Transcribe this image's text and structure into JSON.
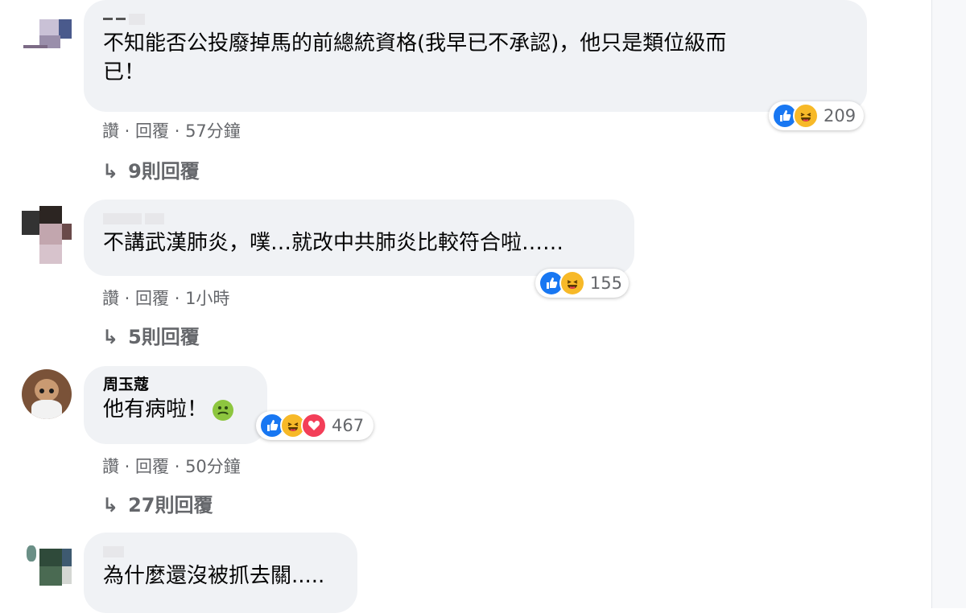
{
  "comments": [
    {
      "author": "",
      "text_line1": "不知能否公投廢掉馬的前總統資格(我早已不承認)，他只是類位級而",
      "text_line2": "已！",
      "like_label": "讚",
      "reply_label": "回覆",
      "time": "57分鐘",
      "reaction_count": "209",
      "replies_label": "9則回覆"
    },
    {
      "author": "",
      "text_line1": "不講武漢肺炎，噗…就改中共肺炎比較符合啦……",
      "like_label": "讚",
      "reply_label": "回覆",
      "time": "1小時",
      "reaction_count": "155",
      "replies_label": "5則回覆"
    },
    {
      "author": "周玉蔻",
      "text_line1": "他有病啦！",
      "like_label": "讚",
      "reply_label": "回覆",
      "time": "50分鐘",
      "reaction_count": "467",
      "replies_label": "27則回覆"
    },
    {
      "author": "",
      "text_line1": "為什麼還沒被抓去關....."
    }
  ],
  "separator": " · ",
  "icons": {
    "reply_arrow": "reply-arrow-icon",
    "like": "like-reaction-icon",
    "haha": "haha-reaction-icon",
    "love": "love-reaction-icon",
    "sick": "nauseated-face-emoji"
  },
  "colors": {
    "bubble": "#f0f2f5",
    "meta_text": "#65676b",
    "like_blue": "#1877f2",
    "haha_yellow": "#f7b928",
    "love_red": "#f33e58"
  }
}
